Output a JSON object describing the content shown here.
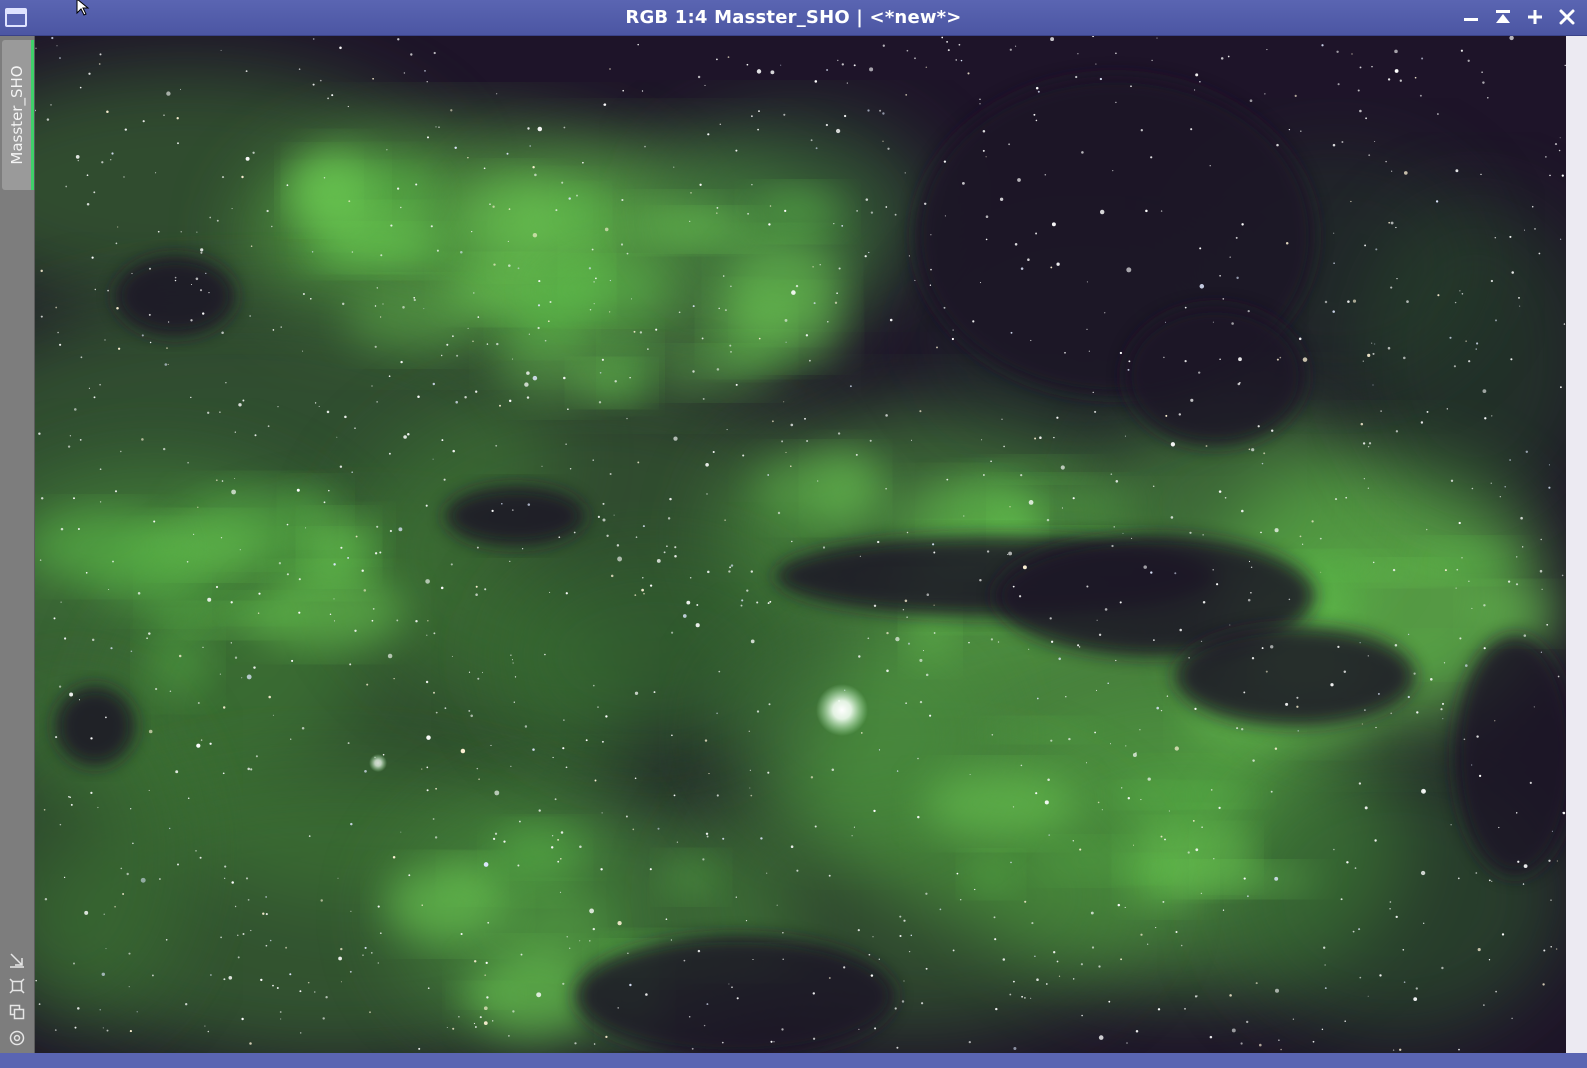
{
  "window": {
    "title": "RGB 1:4 Masster_SHO | <*new*>",
    "controls": {
      "minimize_icon": "minimize-icon",
      "shade_icon": "shade-icon",
      "maximize_icon": "plus-icon",
      "close_icon": "close-icon"
    },
    "titlebar_color": "#5a65b2"
  },
  "sidebar": {
    "view_tab_label": "Masster_SHO",
    "active_indicator_color": "#3fd06a",
    "tools": [
      "fit-view-icon",
      "zoom-to-fit-icon",
      "clone-view-icon",
      "target-icon"
    ]
  },
  "image": {
    "description_kind": "astrophotography-nebula",
    "palette": [
      "#1c1228",
      "#2f5a2a",
      "#4fb43a",
      "#ffffff"
    ]
  }
}
